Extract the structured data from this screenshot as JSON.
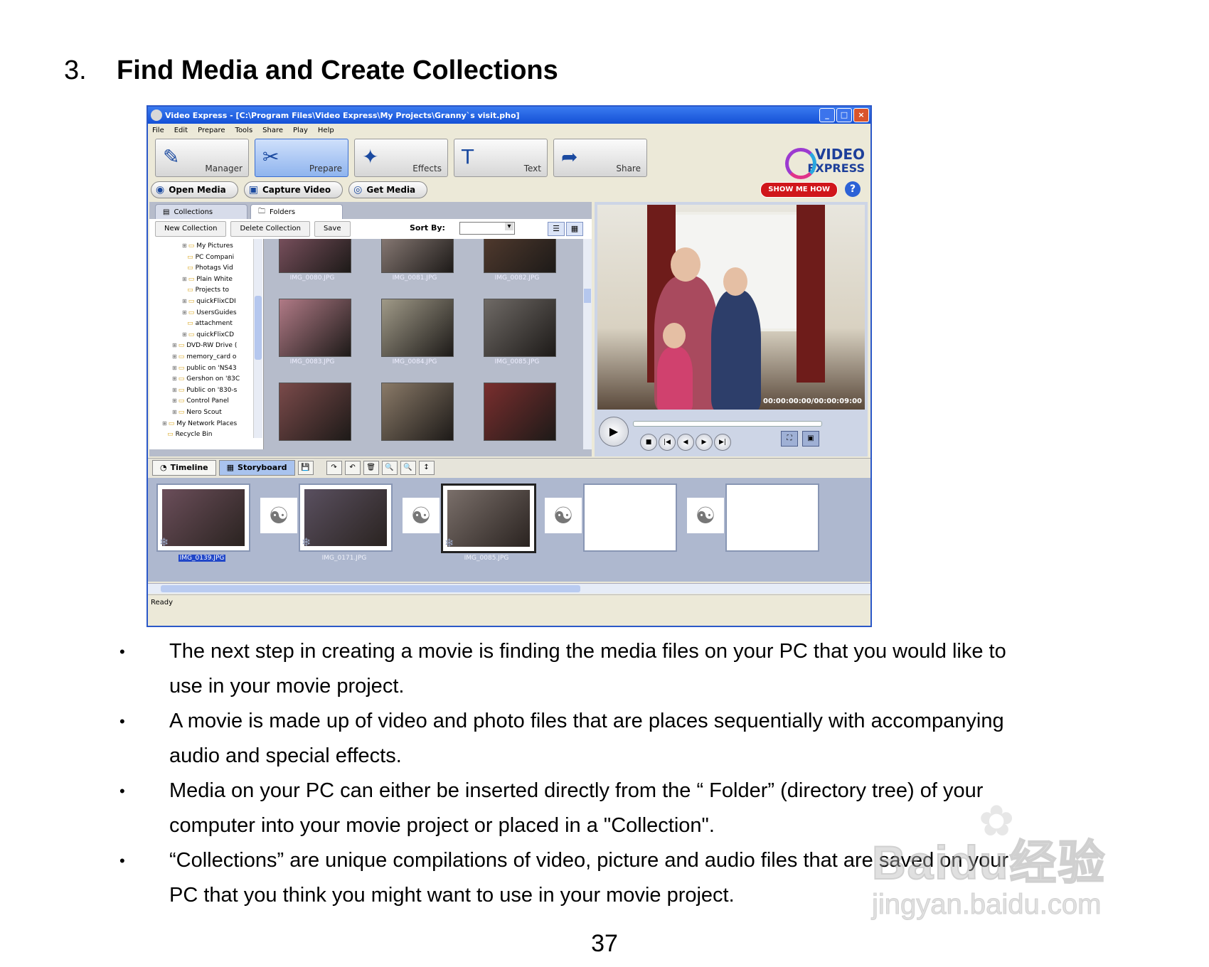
{
  "heading": {
    "number": "3.",
    "title": "Find Media and Create Collections"
  },
  "screenshot": {
    "window_title": "Video Express - [C:\\Program Files\\Video Express\\My Projects\\Granny`s visit.pho]",
    "window_buttons": [
      "_",
      "□",
      "×"
    ],
    "menu": [
      "File",
      "Edit",
      "Prepare",
      "Tools",
      "Share",
      "Play",
      "Help"
    ],
    "modes": [
      {
        "label": "Manager",
        "icon": "manager-icon",
        "active": false
      },
      {
        "label": "Prepare",
        "icon": "prepare-icon",
        "active": true
      },
      {
        "label": "Effects",
        "icon": "effects-icon",
        "active": false
      },
      {
        "label": "Text",
        "icon": "text-icon",
        "active": false
      },
      {
        "label": "Share",
        "icon": "share-icon",
        "active": false
      }
    ],
    "logo_line1": "VIDEO",
    "logo_line2": "EXPRESS",
    "actions": [
      {
        "label": "Open Media",
        "icon": "open-media-icon"
      },
      {
        "label": "Capture Video",
        "icon": "capture-video-icon"
      },
      {
        "label": "Get Media",
        "icon": "get-media-icon"
      }
    ],
    "show_me_how": "SHOW ME HOW",
    "help": "?",
    "browser_tabs": [
      "Collections",
      "Folders"
    ],
    "browser_buttons": [
      "New Collection",
      "Delete Collection",
      "Save"
    ],
    "sort_by_label": "Sort By:",
    "tree_items": [
      {
        "label": "My Pictures",
        "indent": 3,
        "box": "+"
      },
      {
        "label": "PC Compani",
        "indent": 3,
        "box": ""
      },
      {
        "label": "Photags Vid",
        "indent": 3,
        "box": ""
      },
      {
        "label": "Plain White",
        "indent": 3,
        "box": "+"
      },
      {
        "label": "Projects to",
        "indent": 3,
        "box": ""
      },
      {
        "label": "quickFlixCDI",
        "indent": 3,
        "box": "+"
      },
      {
        "label": "UsersGuides",
        "indent": 3,
        "box": "+"
      },
      {
        "label": "attachment",
        "indent": 3,
        "box": ""
      },
      {
        "label": "quickFlixCD",
        "indent": 3,
        "box": "+"
      },
      {
        "label": "DVD-RW Drive (",
        "indent": 2,
        "box": "+"
      },
      {
        "label": "memory_card o",
        "indent": 2,
        "box": "+"
      },
      {
        "label": "public on 'NS43",
        "indent": 2,
        "box": "+"
      },
      {
        "label": "Gershon on '83C",
        "indent": 2,
        "box": "+"
      },
      {
        "label": "Public on '830-s",
        "indent": 2,
        "box": "+"
      },
      {
        "label": "Control Panel",
        "indent": 2,
        "box": "+"
      },
      {
        "label": "Nero Scout",
        "indent": 2,
        "box": "+"
      },
      {
        "label": "My Network Places",
        "indent": 1,
        "box": "+"
      },
      {
        "label": "Recycle Bin",
        "indent": 1,
        "box": ""
      }
    ],
    "thumbnails": [
      {
        "caption": "IMG_0080.JPG",
        "color": "#8a5a6a"
      },
      {
        "caption": "IMG_0081.JPG",
        "color": "#9c8c86"
      },
      {
        "caption": "IMG_0082.JPG",
        "color": "#5a4032"
      },
      {
        "caption": "IMG_0083.JPG",
        "color": "#b07a86"
      },
      {
        "caption": "IMG_0084.JPG",
        "color": "#a09a88"
      },
      {
        "caption": "IMG_0085.JPG",
        "color": "#6f6a66"
      },
      {
        "caption": "",
        "color": "#7a4a4a"
      },
      {
        "caption": "",
        "color": "#8a7a68"
      },
      {
        "caption": "",
        "color": "#7a2e2e"
      }
    ],
    "timecode": "00:00:00:00/00:00:09:00",
    "player_controls": [
      "■",
      "|◀",
      "◀",
      "▶",
      "▶|"
    ],
    "story_tabs": [
      {
        "label": "Timeline",
        "icon": "timeline-icon",
        "active": false
      },
      {
        "label": "Storyboard",
        "icon": "storyboard-icon",
        "active": true
      }
    ],
    "story_tools": [
      "💾",
      "↷",
      "↶",
      "🗑",
      "🔍",
      "🔍",
      "↕"
    ],
    "storyboard": [
      {
        "caption": "IMG_0139.JPG",
        "selected_caption": true,
        "selected_frame": false,
        "empty": false,
        "color": "#6b4e5a"
      },
      {
        "caption": "IMG_0171.JPG",
        "selected_caption": false,
        "selected_frame": false,
        "empty": false,
        "color": "#5a5060"
      },
      {
        "caption": "IMG_0085.JPG",
        "selected_caption": false,
        "selected_frame": true,
        "empty": false,
        "color": "#7a6f6a"
      },
      {
        "caption": "",
        "selected_caption": false,
        "selected_frame": false,
        "empty": true,
        "color": "#ffffff"
      },
      {
        "caption": "",
        "selected_caption": false,
        "selected_frame": false,
        "empty": true,
        "color": "#ffffff"
      }
    ],
    "transition_icon": "☯",
    "status": "Ready"
  },
  "bullets": [
    {
      "line1": "The next step in creating a movie is finding the media files on your PC that you would like to",
      "line2": "use in your movie project."
    },
    {
      "line1": "A movie is made up of video and photo files that are places sequentially with accompanying",
      "line2": "audio and special effects."
    },
    {
      "line1": "Media on your PC can either be inserted directly from the “ Folder” (directory tree) of your",
      "line2": "computer into your movie project or placed in a \"Collection\"."
    },
    {
      "line1": "“Collections” are unique compilations of video, picture and audio files that are saved on your",
      "line2": "PC that you think you might want to use in your movie project."
    }
  ],
  "bullet_char": "•",
  "page_number": "37",
  "watermark": {
    "line1": "Baidu经验",
    "line2": "jingyan.baidu.com"
  }
}
